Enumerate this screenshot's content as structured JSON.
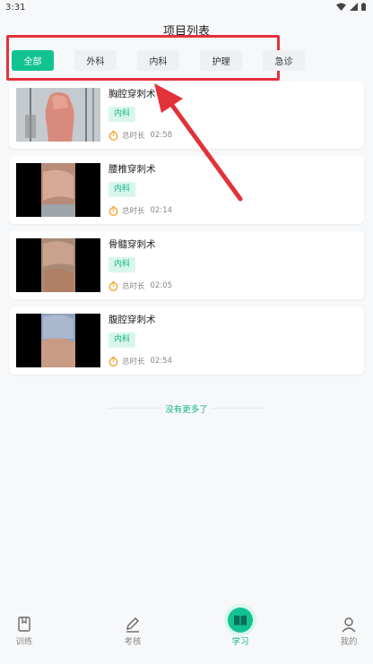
{
  "status_bar": {
    "time": "3:31"
  },
  "header": {
    "title": "项目列表"
  },
  "tabs": [
    {
      "label": "全部",
      "active": true
    },
    {
      "label": "外科",
      "active": false
    },
    {
      "label": "内科",
      "active": false
    },
    {
      "label": "护理",
      "active": false
    },
    {
      "label": "急诊",
      "active": false
    }
  ],
  "items": [
    {
      "title": "胸腔穿刺术",
      "tag": "内科",
      "duration_label": "总时长",
      "duration": "02:58"
    },
    {
      "title": "腰椎穿刺术",
      "tag": "内科",
      "duration_label": "总时长",
      "duration": "02:14"
    },
    {
      "title": "骨髓穿刺术",
      "tag": "内科",
      "duration_label": "总时长",
      "duration": "02:05"
    },
    {
      "title": "腹腔穿刺术",
      "tag": "内科",
      "duration_label": "总时长",
      "duration": "02:54"
    }
  ],
  "list_end_text": "没有更多了",
  "bottom_nav": [
    {
      "label": "训练",
      "icon": "book-icon",
      "active": false
    },
    {
      "label": "考核",
      "icon": "pen-icon",
      "active": false
    },
    {
      "label": "学习",
      "icon": "open-book-icon",
      "active": true
    },
    {
      "label": "我的",
      "icon": "person-icon",
      "active": false
    }
  ],
  "colors": {
    "accent": "#12c392",
    "highlight_box": "#e2323a",
    "tag_bg": "#d9f6ec"
  }
}
